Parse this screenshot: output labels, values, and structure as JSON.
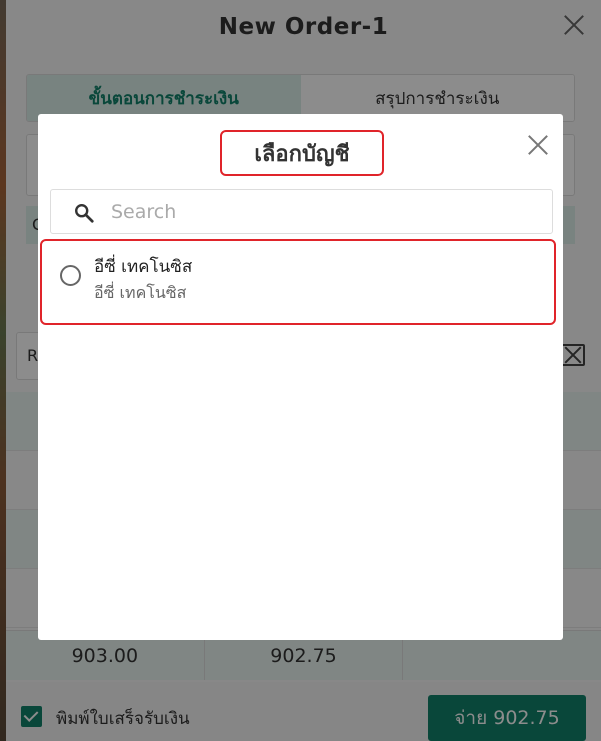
{
  "order_dialog": {
    "title": "New Order-1",
    "tabs": [
      {
        "label": "ขั้นตอนการชำระเงิน",
        "active": true
      },
      {
        "label": "สรุปการชำระเงิน",
        "active": false
      }
    ],
    "band_text": "C",
    "field_text": "R",
    "totals": [
      "903.00",
      "902.75",
      ""
    ],
    "print_receipt_label": "พิมพ์ใบเสร็จรับเงิน",
    "print_receipt_checked": true,
    "pay_button_label": "จ่าย 902.75"
  },
  "modal": {
    "title": "เลือกบัญชี",
    "search_placeholder": "Search",
    "accounts": [
      {
        "name": "อีซี่ เทคโนซิส",
        "subtitle": "อีซี่ เทคโนซิส",
        "selected": false
      }
    ]
  },
  "colors": {
    "primary": "#11826b",
    "highlight": "#e0242a",
    "tab_active_bg": "#dbeee9"
  },
  "icons": [
    "close-icon",
    "search-icon",
    "radio-icon",
    "checkbox-icon"
  ]
}
